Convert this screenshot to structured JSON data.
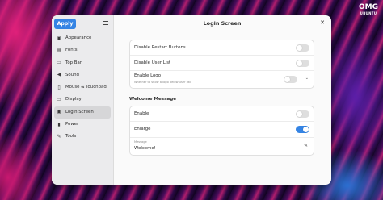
{
  "wallpaper": {
    "logo_big": "OMG",
    "logo_small": "UBUNTU"
  },
  "sidebar": {
    "apply_label": "Apply",
    "menu_icon": "hamburger-menu-icon",
    "items": [
      {
        "label": "Appearance",
        "icon": "appearance-icon",
        "glyph": "▣"
      },
      {
        "label": "Fonts",
        "icon": "fonts-icon",
        "glyph": "▤"
      },
      {
        "label": "Top Bar",
        "icon": "top-bar-icon",
        "glyph": "▭"
      },
      {
        "label": "Sound",
        "icon": "sound-icon",
        "glyph": "◀"
      },
      {
        "label": "Mouse & Touchpad",
        "icon": "mouse-icon",
        "glyph": "▯"
      },
      {
        "label": "Display",
        "icon": "display-icon",
        "glyph": "▭"
      },
      {
        "label": "Login Screen",
        "icon": "login-screen-icon",
        "glyph": "▣"
      },
      {
        "label": "Power",
        "icon": "power-icon",
        "glyph": "▮"
      },
      {
        "label": "Tools",
        "icon": "tools-icon",
        "glyph": "✎"
      }
    ],
    "active_index": 6
  },
  "header": {
    "title": "Login Screen",
    "close_glyph": "✕"
  },
  "general": {
    "disable_restart": {
      "label": "Disable Restart Buttons",
      "enabled": false
    },
    "disable_user_list": {
      "label": "Disable User List",
      "enabled": false
    },
    "enable_logo": {
      "label": "Enable Logo",
      "subtitle": "Whether to show a logo below user list",
      "enabled": false,
      "chevron": "⌄"
    }
  },
  "welcome": {
    "section_title": "Welcome Message",
    "enable": {
      "label": "Enable",
      "enabled": false
    },
    "enlarge": {
      "label": "Enlarge",
      "enabled": true
    },
    "message": {
      "label": "Message",
      "value": "Welcome!",
      "edit_glyph": "✎"
    }
  },
  "colors": {
    "accent": "#3584e4",
    "window_bg": "#fafafa",
    "sidebar_bg": "#ebebed"
  }
}
